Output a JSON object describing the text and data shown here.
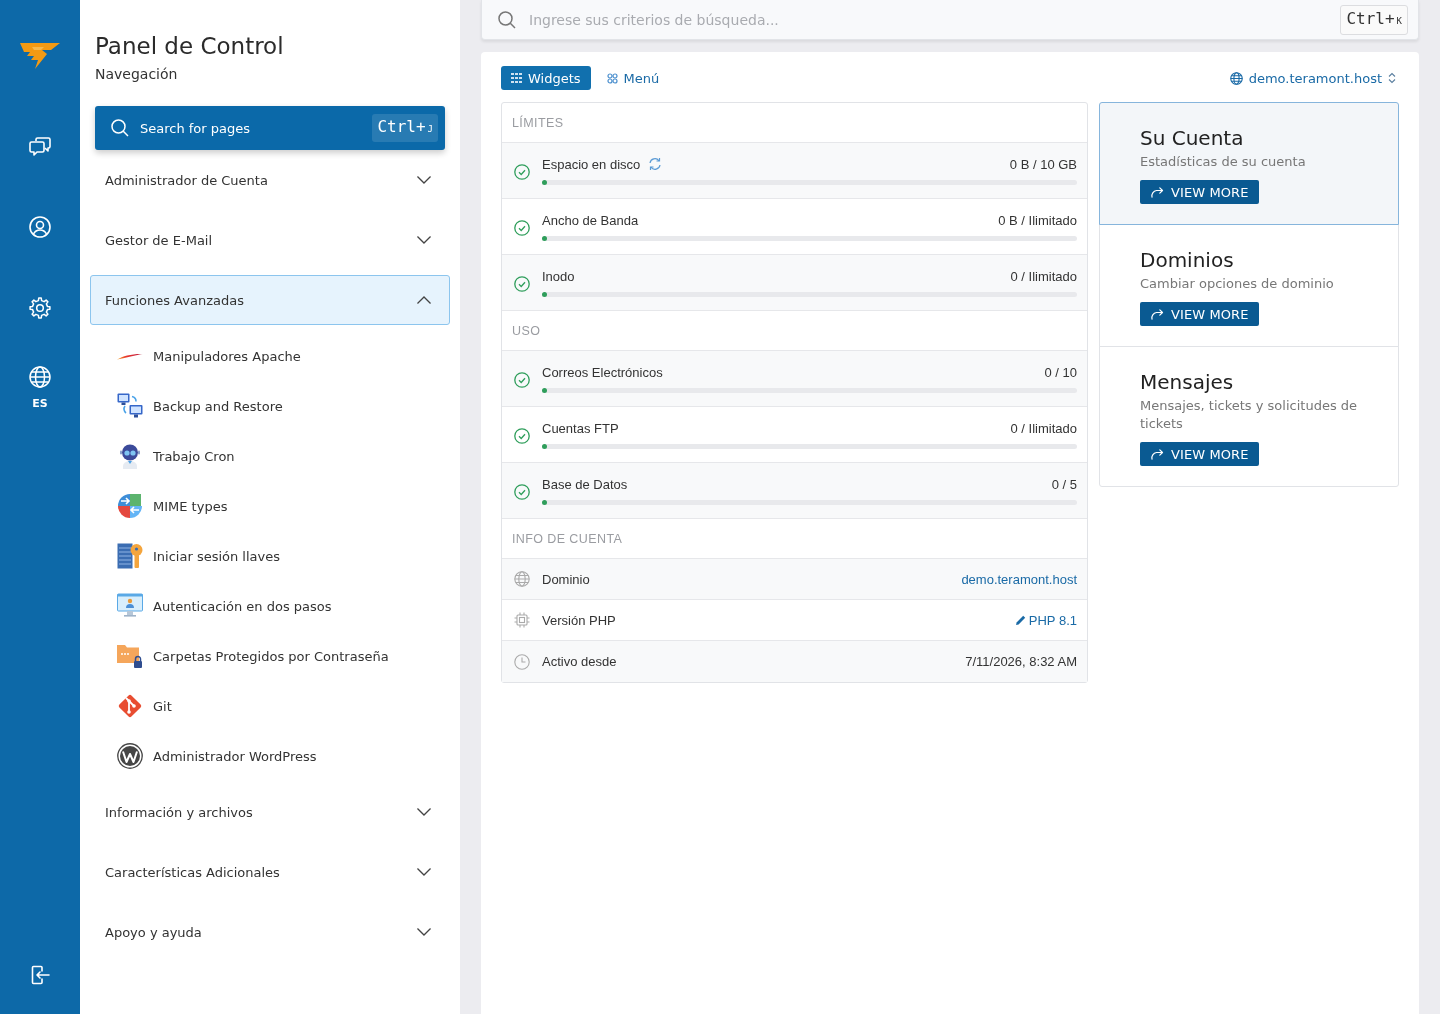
{
  "rail": {
    "language": "ES"
  },
  "sidebar": {
    "title": "Panel de Control",
    "subtitle": "Navegación",
    "search_button": {
      "label": "Search for pages",
      "shortcut": {
        "modifier": "Ctrl+",
        "key": "J"
      }
    },
    "sections": [
      {
        "label": "Administrador de Cuenta",
        "expanded": false
      },
      {
        "label": "Gestor de E-Mail",
        "expanded": false
      },
      {
        "label": "Funciones Avanzadas",
        "expanded": true,
        "children": [
          {
            "label": "Manipuladores Apache"
          },
          {
            "label": "Backup and Restore"
          },
          {
            "label": "Trabajo Cron"
          },
          {
            "label": "MIME types"
          },
          {
            "label": "Iniciar sesión llaves"
          },
          {
            "label": "Autenticación en dos pasos"
          },
          {
            "label": "Carpetas Protegidos por Contraseña"
          },
          {
            "label": "Git"
          },
          {
            "label": "Administrador WordPress"
          }
        ]
      },
      {
        "label": "Información y archivos",
        "expanded": false
      },
      {
        "label": "Características Adicionales",
        "expanded": false
      },
      {
        "label": "Apoyo y ayuda",
        "expanded": false
      }
    ]
  },
  "main": {
    "search": {
      "placeholder": "Ingrese sus criterios de búsqueda...",
      "shortcut": {
        "modifier": "Ctrl+",
        "key": "K"
      }
    },
    "tabs": [
      {
        "label": "Widgets",
        "selected": true
      },
      {
        "label": "Menú",
        "selected": false
      }
    ],
    "domain_selector": {
      "value": "demo.teramont.host"
    },
    "stats": [
      {
        "heading": "LÍMITES",
        "rows": [
          {
            "label": "Espacio en disco",
            "refresh": true,
            "value": "0 B / 10 GB",
            "level": 0
          },
          {
            "label": "Ancho de Banda",
            "refresh": false,
            "value": "0 B / Ilimitado",
            "level": 0
          },
          {
            "label": "Inodo",
            "refresh": false,
            "value": "0 / Ilimitado",
            "level": 0
          }
        ]
      },
      {
        "heading": "USO",
        "rows": [
          {
            "label": "Correos Electrónicos",
            "refresh": false,
            "value": "0 / 10",
            "level": 0
          },
          {
            "label": "Cuentas FTP",
            "refresh": false,
            "value": "0 / Ilimitado",
            "level": 0
          },
          {
            "label": "Base de Datos",
            "refresh": false,
            "value": "0 / 5",
            "level": 0
          }
        ]
      }
    ],
    "account_info": {
      "heading": "INFO DE CUENTA",
      "rows": [
        {
          "label": "Dominio",
          "kind": "link",
          "value": "demo.teramont.host"
        },
        {
          "label": "Versión PHP",
          "kind": "editable",
          "value": "PHP 8.1"
        },
        {
          "label": "Activo desde",
          "kind": "text",
          "value": "7/11/2026, 8:32 AM"
        }
      ]
    },
    "cards": [
      {
        "title": "Su Cuenta",
        "description": "Estadísticas de su cuenta",
        "button": "VIEW MORE",
        "selected": true
      },
      {
        "title": "Dominios",
        "description": "Cambiar opciones de dominio",
        "button": "VIEW MORE",
        "selected": false
      },
      {
        "title": "Mensajes",
        "description": "Mensajes, tickets y solicitudes de tickets",
        "button": "VIEW MORE",
        "selected": false
      }
    ]
  }
}
